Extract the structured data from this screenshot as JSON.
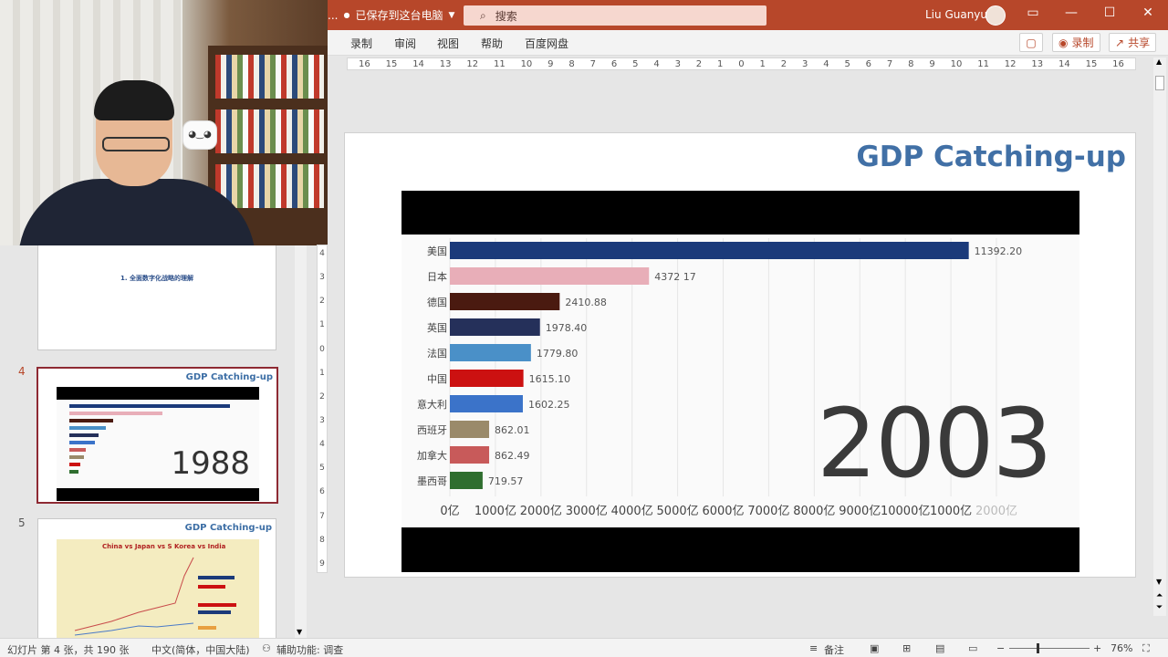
{
  "titlebar": {
    "more_label": "...",
    "save_status": "已保存到这台电脑",
    "search_placeholder": "搜索",
    "user_name": "Liu Guanyu"
  },
  "ribbon": {
    "tabs": [
      "录制",
      "审阅",
      "视图",
      "帮助",
      "百度网盘"
    ],
    "record_label": "录制",
    "share_label": "共享"
  },
  "ruler": {
    "h_ticks": [
      "16",
      "15",
      "14",
      "13",
      "12",
      "11",
      "10",
      "9",
      "8",
      "7",
      "6",
      "5",
      "4",
      "3",
      "2",
      "1",
      "0",
      "1",
      "2",
      "3",
      "4",
      "5",
      "6",
      "7",
      "8",
      "9",
      "10",
      "11",
      "12",
      "13",
      "14",
      "15",
      "16"
    ],
    "v_ticks": [
      "4",
      "3",
      "2",
      "1",
      "0",
      "1",
      "2",
      "3",
      "4",
      "5",
      "6",
      "7",
      "8",
      "9"
    ]
  },
  "thumbnails": {
    "slide3_text": "1. 全面数字化战略的理解",
    "slide4_number": "4",
    "slide4_title": "GDP Catching-up",
    "slide4_year": "1988",
    "slide5_number": "5",
    "slide5_title": "GDP Catching-up",
    "slide5_chart_title": "China vs Japan vs S Korea vs India"
  },
  "slide": {
    "title": "GDP Catching-up",
    "year": "2003"
  },
  "chart_data": {
    "type": "bar",
    "orientation": "horizontal",
    "categories": [
      "美国",
      "日本",
      "德国",
      "英国",
      "法国",
      "中国",
      "意大利",
      "西班牙",
      "加拿大",
      "墨西哥"
    ],
    "values": [
      11392.2,
      4372.17,
      2410.88,
      1978.4,
      1779.8,
      1615.1,
      1602.25,
      862.01,
      862.49,
      719.57
    ],
    "value_labels": [
      "11392.20",
      "4372 17",
      "2410.88",
      "1978.40",
      "1779.80",
      "1615.10",
      "1602.25",
      "862.01",
      "862.49",
      "719.57"
    ],
    "colors": [
      "#1b3a7a",
      "#e8aeb8",
      "#4a1a10",
      "#25305a",
      "#4a90c8",
      "#cc1111",
      "#3b73c9",
      "#9a8a6a",
      "#c85a5a",
      "#2f6e2f"
    ],
    "x_ticks": [
      "0亿",
      "1000亿",
      "2000亿",
      "3000亿",
      "4000亿",
      "5000亿",
      "6000亿",
      "7000亿",
      "8000亿",
      "9000亿",
      "10000亿",
      "1000亿",
      "2000亿"
    ],
    "xlim": [
      0,
      12000
    ]
  },
  "statusbar": {
    "slide_info": "幻灯片 第 4 张，共 190 张",
    "language": "中文(简体，中国大陆)",
    "accessibility": "辅助功能: 调查",
    "notes": "备注",
    "zoom": "76%"
  },
  "colors": {
    "accent": "#b7472a",
    "title_blue": "#4170a6"
  }
}
